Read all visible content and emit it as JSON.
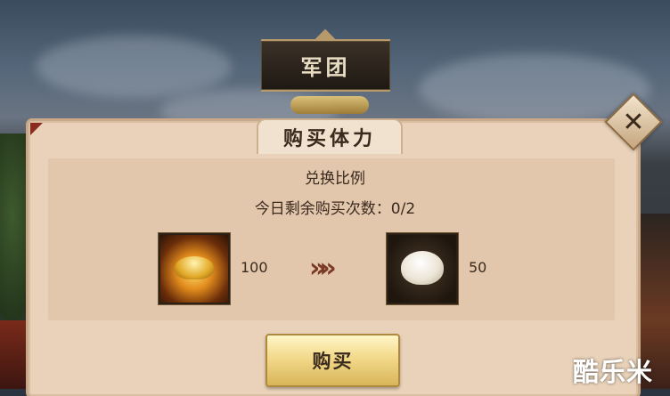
{
  "header": {
    "banner_title": "军团"
  },
  "dialog": {
    "title": "购买体力",
    "exchange_label": "兑换比例",
    "remaining_purchases": "今日剩余购买次数：0/2",
    "cost": {
      "icon": "gold-ingot-icon",
      "amount": "100"
    },
    "reward": {
      "icon": "steamed-bun-icon",
      "amount": "50"
    },
    "arrow_glyph": "»»",
    "buy_label": "购买",
    "close_glyph": "✕"
  },
  "watermark": "酷乐米"
}
